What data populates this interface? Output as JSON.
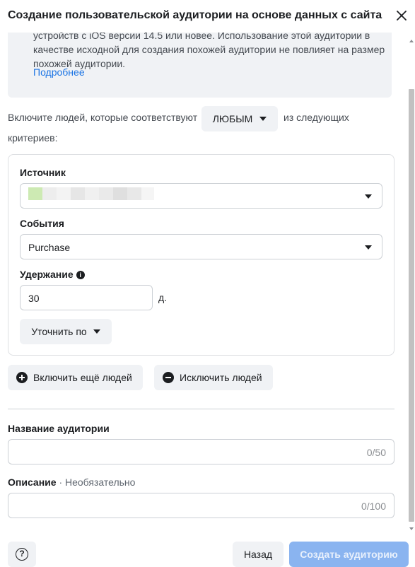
{
  "header": {
    "title": "Создание пользовательской аудитории на основе данных с сайта"
  },
  "info": {
    "text": "устройств с iOS версии 14.5 или новее. Использование этой аудитории в качестве исходной для создания похожей аудитории не повлияет на размер похожей аудитории.",
    "more_link": "Подробнее"
  },
  "criteria": {
    "prefix": "Включите людей, которые соответствуют",
    "match_value": "ЛЮБЫМ",
    "suffix": "из следующих",
    "suffix2": "критериев:"
  },
  "rule": {
    "source_label": "Источник",
    "events_label": "События",
    "events_value": "Purchase",
    "retention_label": "Удержание",
    "retention_value": "30",
    "retention_unit": "д.",
    "refine_button": "Уточнить по"
  },
  "actions": {
    "include_more": "Включить ещё людей",
    "exclude": "Исключить людей"
  },
  "audience": {
    "name_label": "Название аудитории",
    "name_counter": "0/50",
    "description_label": "Описание",
    "description_optional": "· Необязательно",
    "description_counter": "0/100"
  },
  "footer": {
    "back": "Назад",
    "create": "Создать аудиторию"
  },
  "colors": {
    "accent": "#1b74e4",
    "disabled_primary": "#8ab4f0"
  },
  "icons": {
    "close": "close-icon",
    "caret": "caret-down-icon",
    "info": "info-icon",
    "plus": "plus-circle-icon",
    "minus": "minus-circle-icon",
    "help": "help-icon"
  }
}
